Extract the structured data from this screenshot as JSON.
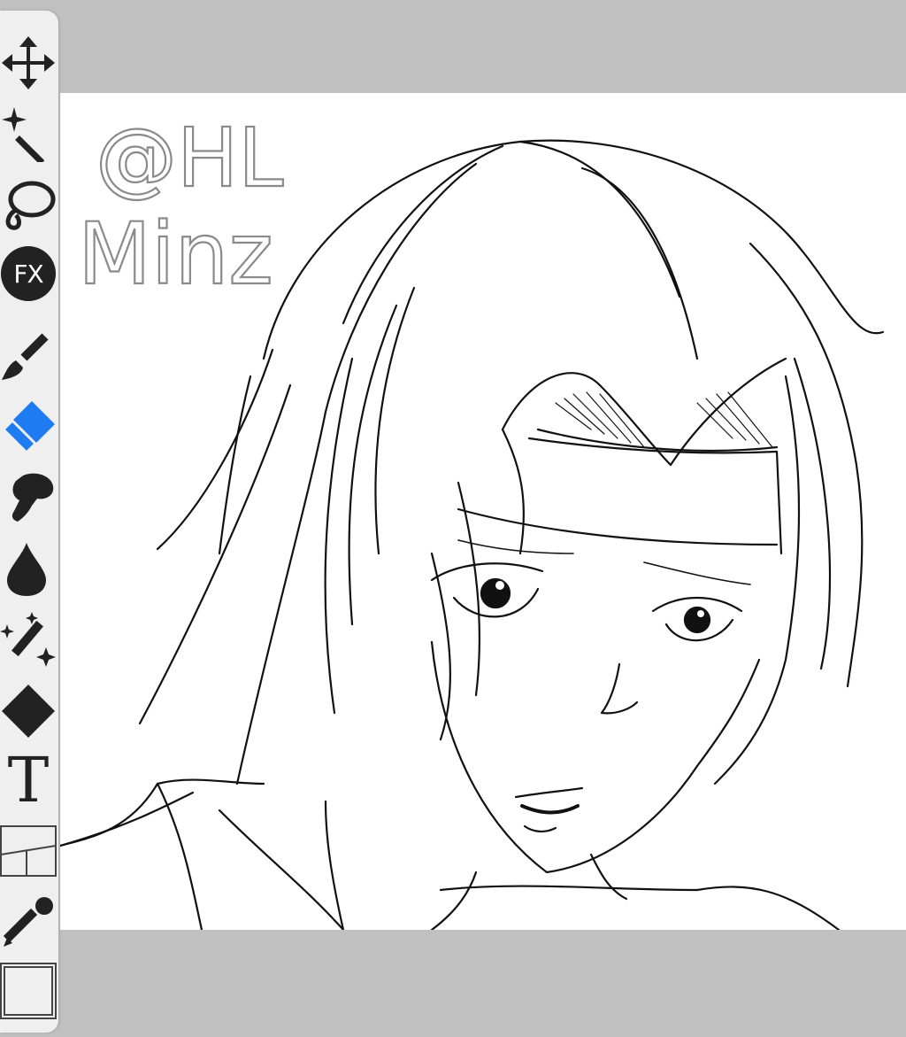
{
  "app": {
    "accent_color": "#1e7bf2",
    "canvas_background": "#ffffff",
    "workspace_background": "#c0c0c0"
  },
  "toolbar": {
    "tools": [
      {
        "id": "transform",
        "icon": "move-arrows-icon",
        "active": false
      },
      {
        "id": "magic-wand",
        "icon": "magic-wand-icon",
        "active": false
      },
      {
        "id": "lasso",
        "icon": "lasso-icon",
        "active": false
      },
      {
        "id": "filter",
        "icon": "fx-icon",
        "label": "FX",
        "active": false
      },
      {
        "id": "brush",
        "icon": "brush-icon",
        "active": false
      },
      {
        "id": "eraser",
        "icon": "eraser-icon",
        "active": true
      },
      {
        "id": "smudge",
        "icon": "finger-smudge-icon",
        "active": false
      },
      {
        "id": "blur",
        "icon": "water-drop-icon",
        "active": false
      },
      {
        "id": "sparkle-brush",
        "icon": "sparkle-pen-icon",
        "active": false
      },
      {
        "id": "fill",
        "icon": "diamond-fill-icon",
        "active": false
      },
      {
        "id": "text",
        "icon": "text-icon",
        "label": "T",
        "active": false
      },
      {
        "id": "frame-divider",
        "icon": "frame-divider-icon",
        "active": false
      },
      {
        "id": "eyedropper",
        "icon": "eyedropper-icon",
        "active": false
      },
      {
        "id": "canvas",
        "icon": "canvas-square-icon",
        "active": false
      }
    ]
  },
  "canvas": {
    "watermark_line1": "@HL",
    "watermark_line2": "Minz"
  }
}
